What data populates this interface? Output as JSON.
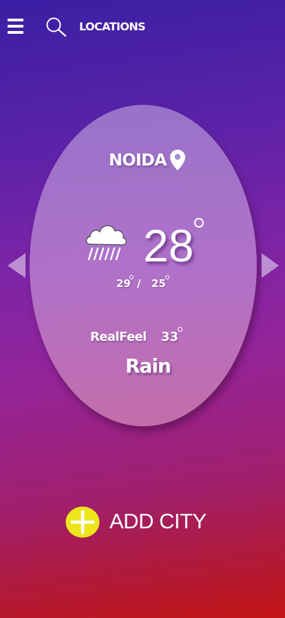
{
  "header": {
    "menu_icon": "hamburger-menu-icon",
    "search_icon": "search-icon",
    "locations_label": "LOCATIONS"
  },
  "weather": {
    "city": "NOIDA",
    "location_icon": "map-pin-icon",
    "condition_icon": "rain-cloud-icon",
    "temperature": "28",
    "high": "29",
    "separator": "/",
    "low": "25",
    "realfeel_label": "RealFeel",
    "realfeel_value": "33",
    "condition": "Rain"
  },
  "navigation": {
    "prev_icon": "left-triangle-icon",
    "next_icon": "right-triangle-icon"
  },
  "add_city": {
    "icon": "plus-circle-icon",
    "label": "ADD CITY"
  },
  "colors": {
    "gradient_top": "#3a1fa4",
    "gradient_mid": "#93249a",
    "gradient_bottom": "#c41616",
    "plus_circle": "#ede51c",
    "card": "#b888d2"
  }
}
